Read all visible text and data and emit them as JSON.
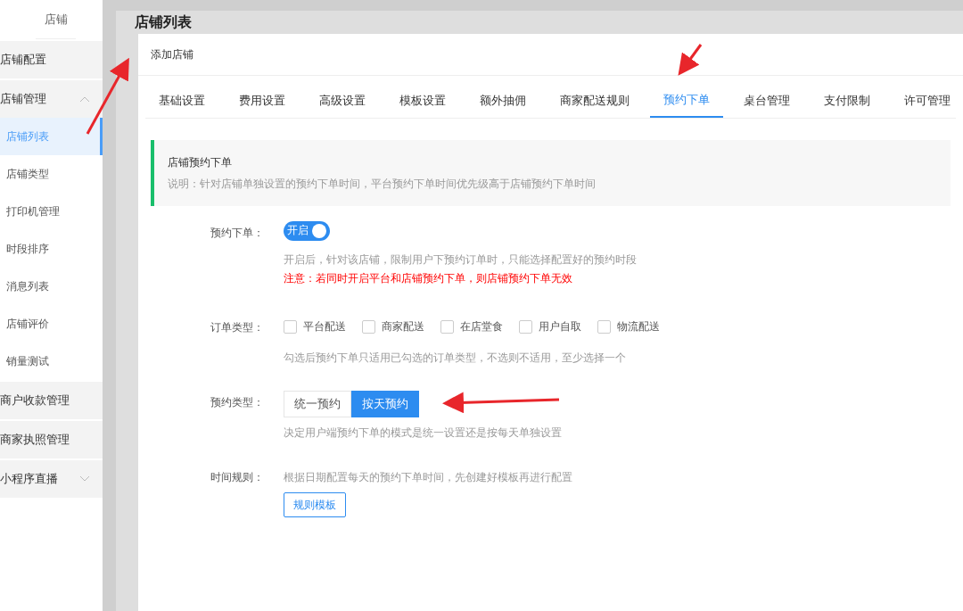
{
  "sidebar": {
    "title": "店铺",
    "items": [
      {
        "label": "店铺配置",
        "kind": "group"
      },
      {
        "label": "店铺管理",
        "kind": "group",
        "expanded": true,
        "children": [
          {
            "label": "店铺列表",
            "selected": true
          },
          {
            "label": "店铺类型",
            "selected": false
          },
          {
            "label": "打印机管理",
            "selected": false
          },
          {
            "label": "时段排序",
            "selected": false
          },
          {
            "label": "消息列表",
            "selected": false
          },
          {
            "label": "店铺评价",
            "selected": false
          },
          {
            "label": "销量测试",
            "selected": false
          }
        ]
      },
      {
        "label": "商户收款管理",
        "kind": "group"
      },
      {
        "label": "商家执照管理",
        "kind": "group"
      },
      {
        "label": "小程序直播",
        "kind": "group",
        "expanded": false
      }
    ]
  },
  "page": {
    "title": "店铺列表"
  },
  "dialog": {
    "title": "添加店铺",
    "tabs": [
      {
        "label": "基础设置",
        "selected": false
      },
      {
        "label": "费用设置",
        "selected": false
      },
      {
        "label": "高级设置",
        "selected": false
      },
      {
        "label": "模板设置",
        "selected": false
      },
      {
        "label": "额外抽佣",
        "selected": false
      },
      {
        "label": "商家配送规则",
        "selected": false
      },
      {
        "label": "预约下单",
        "selected": true
      },
      {
        "label": "桌台管理",
        "selected": false
      },
      {
        "label": "支付限制",
        "selected": false
      },
      {
        "label": "许可管理",
        "selected": false
      }
    ],
    "notice": {
      "title": "店铺预约下单",
      "text": "说明：针对店铺单独设置的预约下单时间，平台预约下单时间优先级高于店铺预约下单时间"
    },
    "form": {
      "preorder": {
        "label": "预约下单：",
        "switch_text": "开启",
        "on": true,
        "hint": "开启后，针对该店铺，限制用户下预约订单时，只能选择配置好的预约时段",
        "warning": "注意：若同时开启平台和店铺预约下单，则店铺预约下单无效"
      },
      "order_types": {
        "label": "订单类型：",
        "options": [
          {
            "label": "平台配送",
            "checked": false
          },
          {
            "label": "商家配送",
            "checked": false
          },
          {
            "label": "在店堂食",
            "checked": false
          },
          {
            "label": "用户自取",
            "checked": false
          },
          {
            "label": "物流配送",
            "checked": false
          }
        ],
        "hint": "勾选后预约下单只适用已勾选的订单类型，不选则不适用，至少选择一个"
      },
      "preorder_type": {
        "label": "预约类型：",
        "options": [
          {
            "label": "统一预约",
            "selected": false
          },
          {
            "label": "按天预约",
            "selected": true
          }
        ],
        "hint": "决定用户端预约下单的模式是统一设置还是按每天单独设置"
      },
      "time_rule": {
        "label": "时间规则：",
        "hint": "根据日期配置每天的预约下单时间，先创建好模板再进行配置",
        "button": "规则模板"
      }
    }
  }
}
